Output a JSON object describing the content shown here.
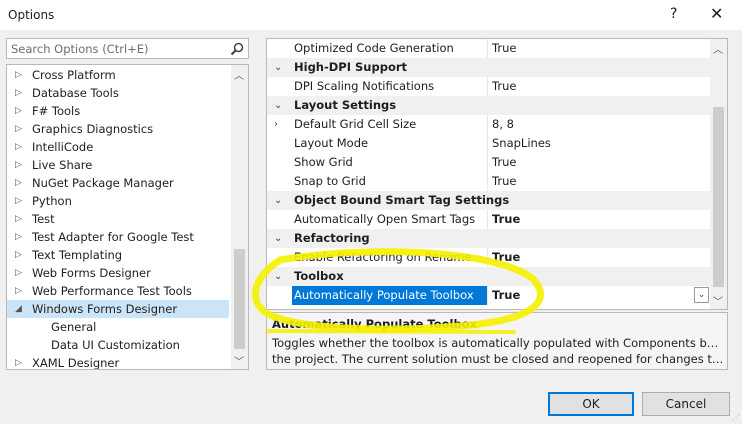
{
  "window": {
    "title": "Options",
    "help_label": "?",
    "close_label": "✕"
  },
  "search": {
    "placeholder": "Search Options (Ctrl+E)"
  },
  "tree": {
    "items": [
      {
        "label": "Cross Platform",
        "expander": "▷",
        "level": 0,
        "selected": false
      },
      {
        "label": "Database Tools",
        "expander": "▷",
        "level": 0,
        "selected": false
      },
      {
        "label": "F# Tools",
        "expander": "▷",
        "level": 0,
        "selected": false
      },
      {
        "label": "Graphics Diagnostics",
        "expander": "▷",
        "level": 0,
        "selected": false
      },
      {
        "label": "IntelliCode",
        "expander": "▷",
        "level": 0,
        "selected": false
      },
      {
        "label": "Live Share",
        "expander": "▷",
        "level": 0,
        "selected": false
      },
      {
        "label": "NuGet Package Manager",
        "expander": "▷",
        "level": 0,
        "selected": false
      },
      {
        "label": "Python",
        "expander": "▷",
        "level": 0,
        "selected": false
      },
      {
        "label": "Test",
        "expander": "▷",
        "level": 0,
        "selected": false
      },
      {
        "label": "Test Adapter for Google Test",
        "expander": "▷",
        "level": 0,
        "selected": false
      },
      {
        "label": "Text Templating",
        "expander": "▷",
        "level": 0,
        "selected": false
      },
      {
        "label": "Web Forms Designer",
        "expander": "▷",
        "level": 0,
        "selected": false
      },
      {
        "label": "Web Performance Test Tools",
        "expander": "▷",
        "level": 0,
        "selected": false
      },
      {
        "label": "Windows Forms Designer",
        "expander": "◢",
        "level": 0,
        "selected": true
      },
      {
        "label": "General",
        "expander": "",
        "level": 1,
        "selected": false
      },
      {
        "label": "Data UI Customization",
        "expander": "",
        "level": 1,
        "selected": false
      },
      {
        "label": "XAML Designer",
        "expander": "▷",
        "level": 0,
        "selected": false
      }
    ]
  },
  "grid": {
    "rows": [
      {
        "type": "prop",
        "name": "Optimized Code Generation",
        "value": "True",
        "bold": false
      },
      {
        "type": "cat",
        "name": "High-DPI Support"
      },
      {
        "type": "prop",
        "name": "DPI Scaling Notifications",
        "value": "True",
        "bold": false
      },
      {
        "type": "cat",
        "name": "Layout Settings"
      },
      {
        "type": "prop",
        "name": "Default Grid Cell Size",
        "value": "8, 8",
        "bold": false,
        "expandable": true
      },
      {
        "type": "prop",
        "name": "Layout Mode",
        "value": "SnapLines",
        "bold": false
      },
      {
        "type": "prop",
        "name": "Show Grid",
        "value": "True",
        "bold": false
      },
      {
        "type": "prop",
        "name": "Snap to Grid",
        "value": "True",
        "bold": false
      },
      {
        "type": "cat",
        "name": "Object Bound Smart Tag Settings"
      },
      {
        "type": "prop",
        "name": "Automatically Open Smart Tags",
        "value": "True",
        "bold": true
      },
      {
        "type": "cat",
        "name": "Refactoring"
      },
      {
        "type": "prop",
        "name": "Enable Refactoring on Rename",
        "value": "True",
        "bold": true
      },
      {
        "type": "cat",
        "name": "Toolbox"
      },
      {
        "type": "prop",
        "name": "Automatically Populate Toolbox",
        "value": "True",
        "bold": true,
        "selected": true
      }
    ]
  },
  "description": {
    "title": "Automatically Populate Toolbox",
    "line1": "Toggles whether the toolbox is automatically populated with Components built by",
    "line2": "the project.  The current solution must be closed and reopened for changes to ta..."
  },
  "buttons": {
    "ok": "OK",
    "cancel": "Cancel"
  },
  "colors": {
    "accent": "#0078d7",
    "highlight_marker": "#f5f000"
  }
}
